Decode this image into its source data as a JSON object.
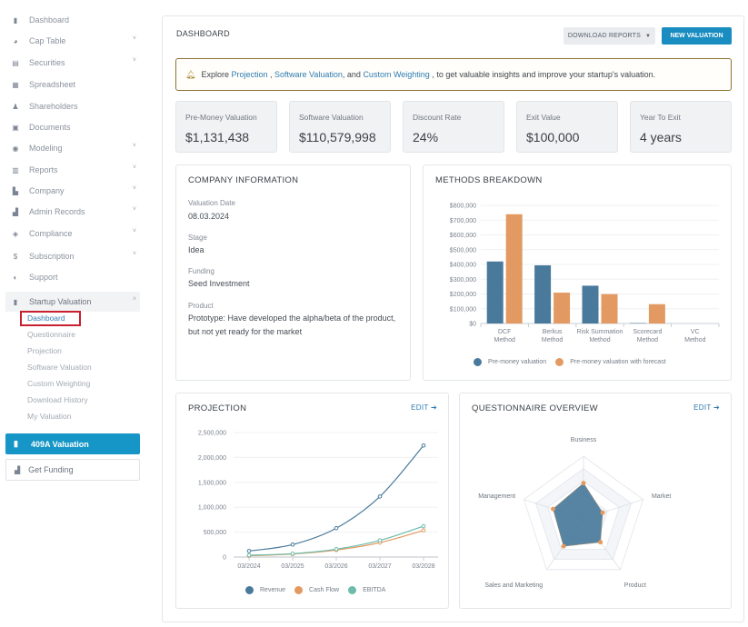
{
  "sidebar": {
    "items": [
      {
        "label": "Dashboard",
        "icon": "dashboard-icon",
        "glyph": "▮",
        "chevron": false
      },
      {
        "label": "Cap Table",
        "icon": "pie-chart-icon",
        "glyph": "◕",
        "chevron": true
      },
      {
        "label": "Securities",
        "icon": "clipboard-icon",
        "glyph": "▤",
        "chevron": true
      },
      {
        "label": "Spreadsheet",
        "icon": "spreadsheet-icon",
        "glyph": "▦",
        "chevron": false
      },
      {
        "label": "Shareholders",
        "icon": "user-icon",
        "glyph": "♟",
        "chevron": false
      },
      {
        "label": "Documents",
        "icon": "folder-icon",
        "glyph": "▣",
        "chevron": false
      },
      {
        "label": "Modeling",
        "icon": "lightbulb-icon",
        "glyph": "◉",
        "chevron": true
      },
      {
        "label": "Reports",
        "icon": "report-icon",
        "glyph": "▥",
        "chevron": true
      },
      {
        "label": "Company",
        "icon": "building-icon",
        "glyph": "▙",
        "chevron": true
      },
      {
        "label": "Admin Records",
        "icon": "records-icon",
        "glyph": "▟",
        "chevron": true
      },
      {
        "label": "Compliance",
        "icon": "shield-icon",
        "glyph": "◈",
        "chevron": true
      },
      {
        "label": "Subscription",
        "icon": "dollar-icon",
        "glyph": "$",
        "chevron": true
      },
      {
        "label": "Support",
        "icon": "support-icon",
        "glyph": "◐",
        "chevron": false
      }
    ],
    "group": {
      "label": "Startup Valuation",
      "icon": "document-icon",
      "expanded": true,
      "children": [
        "Dashboard",
        "Questionnaire",
        "Projection",
        "Software Valuation",
        "Custom Weighting",
        "Download History",
        "My Valuation"
      ],
      "active_child": "Dashboard"
    },
    "button_409a": "409A Valuation",
    "button_funding": "Get Funding"
  },
  "header": {
    "title": "DASHBOARD",
    "download_reports": "DOWNLOAD REPORTS",
    "new_valuation": "NEW VALUATION"
  },
  "banner": {
    "prefix": "Explore ",
    "link1": "Projection",
    "sep1": " , ",
    "link2": "Software Valuation",
    "sep2": ", and ",
    "link3": "Custom Weighting",
    "suffix": " , to get valuable insights and improve your startup's valuation."
  },
  "stats": [
    {
      "label": "Pre-Money Valuation",
      "value": "$1,131,438"
    },
    {
      "label": "Software Valuation",
      "value": "$110,579,998"
    },
    {
      "label": "Discount Rate",
      "value": "24%"
    },
    {
      "label": "Exit Value",
      "value": "$100,000"
    },
    {
      "label": "Year To Exit",
      "value": "4 years"
    }
  ],
  "company_info": {
    "title": "COMPANY INFORMATION",
    "fields": [
      {
        "label": "Valuation Date",
        "value": "08.03.2024"
      },
      {
        "label": "Stage",
        "value": "Idea"
      },
      {
        "label": "Funding",
        "value": "Seed Investment"
      },
      {
        "label": "Product",
        "value": "Prototype: Have developed the alpha/beta of the product, but not yet ready for the market"
      }
    ]
  },
  "methods": {
    "title": "METHODS BREAKDOWN"
  },
  "projection": {
    "title": "PROJECTION",
    "edit": "EDIT"
  },
  "questionnaire": {
    "title": "QUESTIONNAIRE OVERVIEW",
    "edit": "EDIT"
  },
  "colors": {
    "blue": "#4a7a9b",
    "orange": "#e39a62",
    "teal": "#6dbcab",
    "accent": "#1a8dc0"
  },
  "chart_data": [
    {
      "type": "bar",
      "title": "METHODS BREAKDOWN",
      "categories": [
        [
          "DCF",
          "Method"
        ],
        [
          "Berkus",
          "Method"
        ],
        [
          "Risk Summation",
          "Method"
        ],
        [
          "Scorecard",
          "Method"
        ],
        [
          "VC",
          "Method"
        ]
      ],
      "series": [
        {
          "name": "Pre-money valuation",
          "color": "#4a7a9b",
          "values": [
            420000,
            394000,
            256000,
            3000,
            0
          ]
        },
        {
          "name": "Pre-money valuation with forecast",
          "color": "#e39a62",
          "values": [
            740000,
            209000,
            199000,
            131000,
            0
          ]
        }
      ],
      "yticks": [
        "$0",
        "$100,000",
        "$200,000",
        "$300,000",
        "$400,000",
        "$500,000",
        "$600,000",
        "$700,000",
        "$800,000"
      ],
      "ylim": [
        0,
        800000
      ],
      "legend": "bottom",
      "grid": true
    },
    {
      "type": "line",
      "title": "PROJECTION",
      "x": [
        "03/2024",
        "03/2025",
        "03/2026",
        "03/2027",
        "03/2028"
      ],
      "series": [
        {
          "name": "Revenue",
          "color": "#4a7a9b",
          "values": [
            120000,
            250000,
            580000,
            1215000,
            2240000
          ]
        },
        {
          "name": "Cash Flow",
          "color": "#e39a62",
          "values": [
            25000,
            60000,
            140000,
            290000,
            535000
          ]
        },
        {
          "name": "EBITDA",
          "color": "#6dbcab",
          "values": [
            36000,
            67000,
            158000,
            334000,
            620000
          ]
        }
      ],
      "yticks": [
        "0",
        "500,000",
        "1,000,000",
        "1,500,000",
        "2,000,000",
        "2,500,000"
      ],
      "ylim": [
        0,
        2500000
      ],
      "legend": "bottom",
      "grid": true
    },
    {
      "type": "radar",
      "title": "QUESTIONNAIRE OVERVIEW",
      "axes": [
        "Business",
        "Market",
        "Product",
        "Sales and Marketing",
        "Management"
      ],
      "values": [
        0.57,
        0.32,
        0.46,
        0.54,
        0.51
      ],
      "range": [
        0,
        1
      ],
      "fill": "#4a7a9b",
      "point_color": "#e39a62"
    }
  ]
}
